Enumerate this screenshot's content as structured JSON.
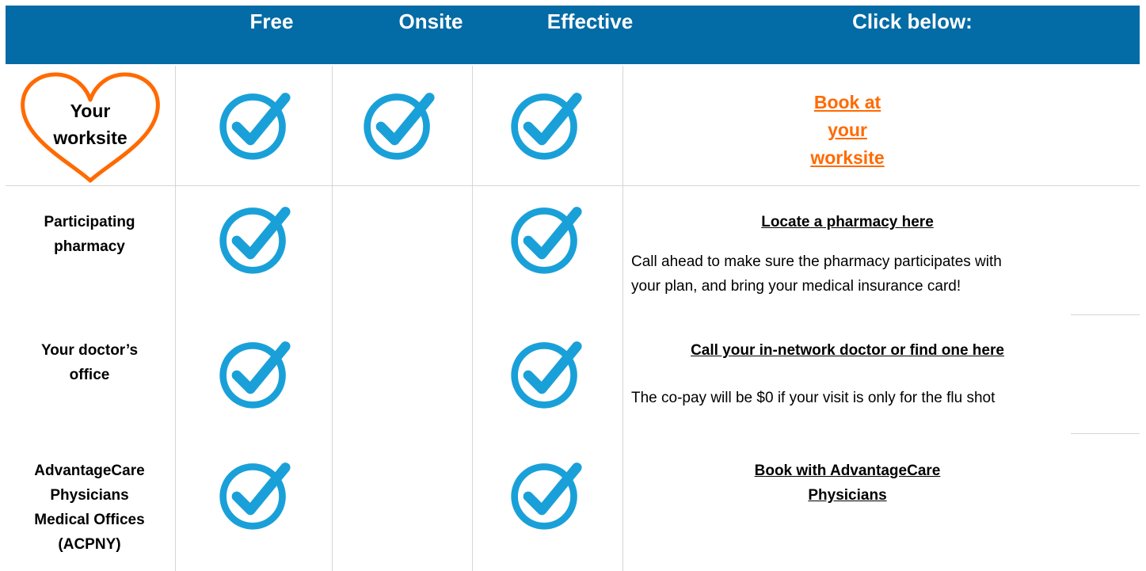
{
  "header": {
    "col_free": "Free",
    "col_onsite": "Onsite",
    "col_effective": "Effective",
    "col_action": "Click below:"
  },
  "rows": [
    {
      "label_lines": [
        "Your",
        "worksite"
      ],
      "free": true,
      "onsite": true,
      "effective": true,
      "link_lines": [
        "Book at",
        "your",
        "worksite"
      ]
    },
    {
      "label_lines": [
        "Participating",
        "pharmacy"
      ],
      "free": true,
      "onsite": false,
      "effective": true,
      "link": "Locate a pharmacy here",
      "note_lines": [
        "Call ahead to make sure the pharmacy participates with",
        "your plan, and bring your medical insurance card!"
      ]
    },
    {
      "label_lines": [
        "Your doctor’s",
        "office"
      ],
      "free": true,
      "onsite": false,
      "effective": true,
      "link": "Call your in-network doctor or find one here",
      "note": "The co-pay will be $0 if your visit is only for the flu shot"
    },
    {
      "label_lines": [
        "AdvantageCare",
        "Physicians",
        "Medical Offices",
        "(ACPNY)"
      ],
      "free": true,
      "onsite": false,
      "effective": true,
      "link_lines": [
        "Book with AdvantageCare",
        "Physicians"
      ]
    }
  ],
  "colors": {
    "header_bg": "#036ba5",
    "check_blue": "#1aa0d8",
    "heart_orange": "#ff6a00",
    "link_orange": "#ff6a00"
  },
  "icons": {
    "check": "checkmark-circle-icon",
    "heart": "heart-outline-icon"
  }
}
